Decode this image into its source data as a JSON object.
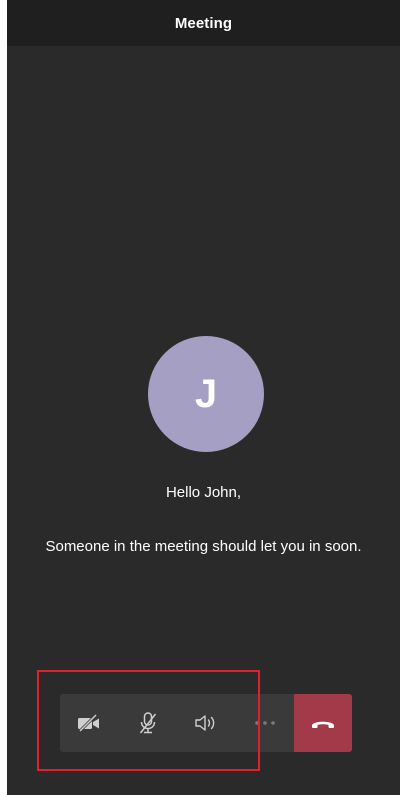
{
  "header": {
    "title": "Meeting"
  },
  "participant": {
    "initial": "J"
  },
  "lobby": {
    "greeting": "Hello John,",
    "message": "Someone in the meeting should let you in soon."
  },
  "call_controls": {
    "icons": [
      "video-off-icon",
      "mic-off-icon",
      "speaker-icon",
      "more-icon",
      "hang-up-icon"
    ]
  },
  "colors": {
    "background": "#2a2a2a",
    "header": "#1f1f1f",
    "avatar": "#a59fc4",
    "controls_bg": "#3a3a3a",
    "control_icon": "#cfcfcf",
    "more_icon": "#7a7a7a",
    "hangup": "#a33a4a",
    "highlight": "#e0202a"
  }
}
